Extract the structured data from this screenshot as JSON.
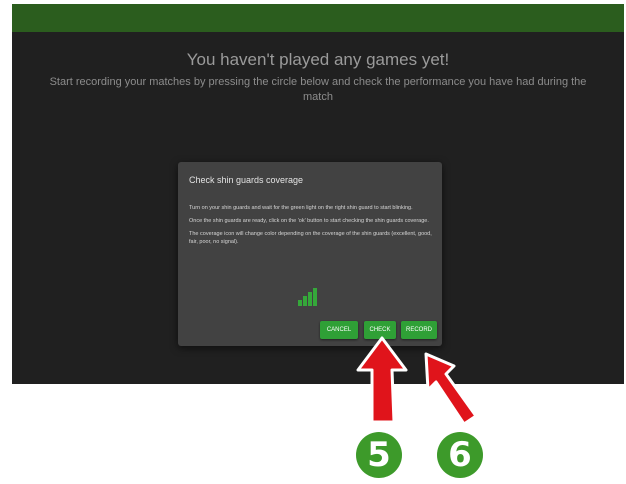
{
  "header": {
    "color": "#2b5d1e"
  },
  "empty_state": {
    "title": "You haven't played any games yet!",
    "subtitle": "Start recording your matches by pressing the circle below and check the performance you have had during the match"
  },
  "dialog": {
    "title": "Check shin guards coverage",
    "paragraphs": [
      "Turn on your shin guards and wait for the green light on the right shin guard to start blinking.",
      "Once the shin guards are ready, click on the 'ok' button to start checking the shin guards coverage.",
      "The coverage icon will change color depending on the coverage of the shin guards (excellent, good, fair, poor, no signal)."
    ],
    "coverage_icon": "signal-bars-icon",
    "coverage_color": "#35a83a",
    "buttons": {
      "cancel": "CANCEL",
      "check": "CHECK",
      "record": "RECORD"
    },
    "button_color": "#2fa036"
  },
  "annotations": [
    {
      "number": "5",
      "target": "CHECK"
    },
    {
      "number": "6",
      "target": "RECORD"
    }
  ],
  "arrow_color": "#e0141b",
  "marker_color": "#3d9a2a"
}
